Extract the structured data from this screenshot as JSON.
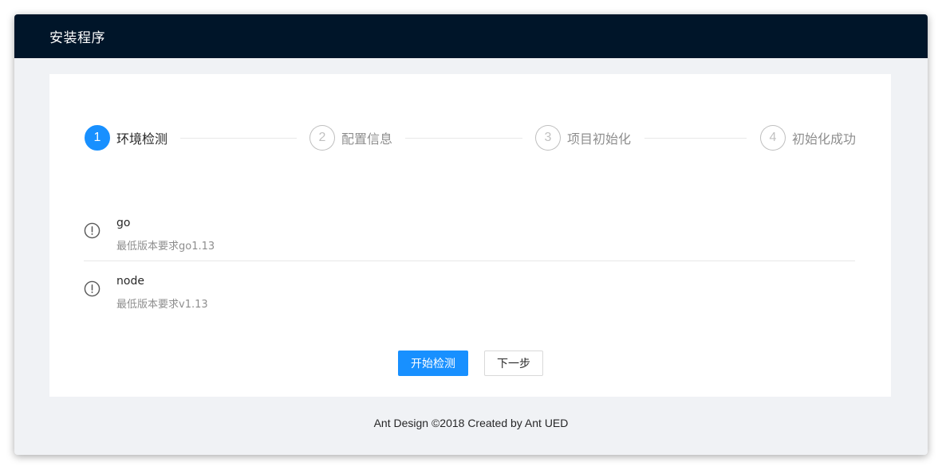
{
  "header": {
    "title": "安装程序"
  },
  "steps": [
    {
      "number": "1",
      "title": "环境检测",
      "status": "active"
    },
    {
      "number": "2",
      "title": "配置信息",
      "status": "wait"
    },
    {
      "number": "3",
      "title": "项目初始化",
      "status": "wait"
    },
    {
      "number": "4",
      "title": "初始化成功",
      "status": "wait"
    }
  ],
  "checks": [
    {
      "name": "go",
      "requirement": "最低版本要求go1.13",
      "icon": "exclamation-circle-icon"
    },
    {
      "name": "node",
      "requirement": "最低版本要求v1.13",
      "icon": "exclamation-circle-icon"
    }
  ],
  "actions": {
    "start_label": "开始检测",
    "next_label": "下一步"
  },
  "footer": {
    "text": "Ant Design ©2018 Created by Ant UED"
  },
  "colors": {
    "header_bg": "#001529",
    "primary": "#1890ff",
    "page_bg": "#f0f2f5"
  }
}
